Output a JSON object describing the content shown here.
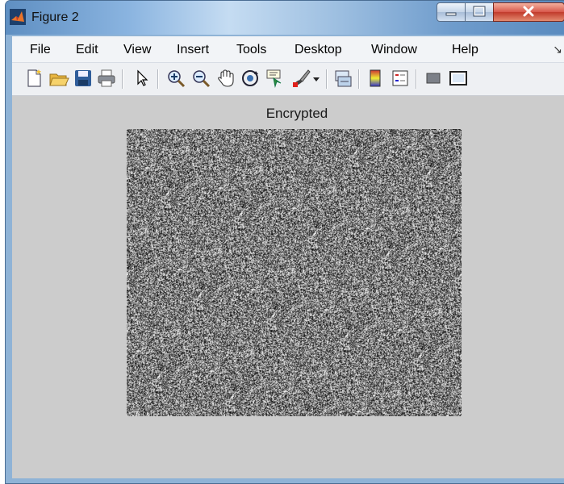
{
  "window": {
    "title": "Figure 2",
    "icon": "matlab-logo-icon",
    "controls": [
      "minimize-icon",
      "maximize-icon",
      "close-icon"
    ]
  },
  "menu": {
    "items": [
      "File",
      "Edit",
      "View",
      "Insert",
      "Tools",
      "Desktop",
      "Window",
      "Help"
    ],
    "overflow_icon": "chevron-right-icon"
  },
  "toolbar": {
    "tools": [
      "new-figure-icon",
      "open-file-icon",
      "save-icon",
      "print-icon",
      "pointer-icon",
      "zoom-in-icon",
      "zoom-out-icon",
      "pan-icon",
      "rotate-3d-icon",
      "data-cursor-icon",
      "brush-icon",
      "brush-dropdown-icon",
      "link-plot-icon",
      "insert-colorbar-icon",
      "insert-legend-icon",
      "hide-plot-tools-icon",
      "show-plot-tools-icon"
    ]
  },
  "figure": {
    "title": "Encrypted",
    "image": "noise-image",
    "background": "#cccccc"
  }
}
